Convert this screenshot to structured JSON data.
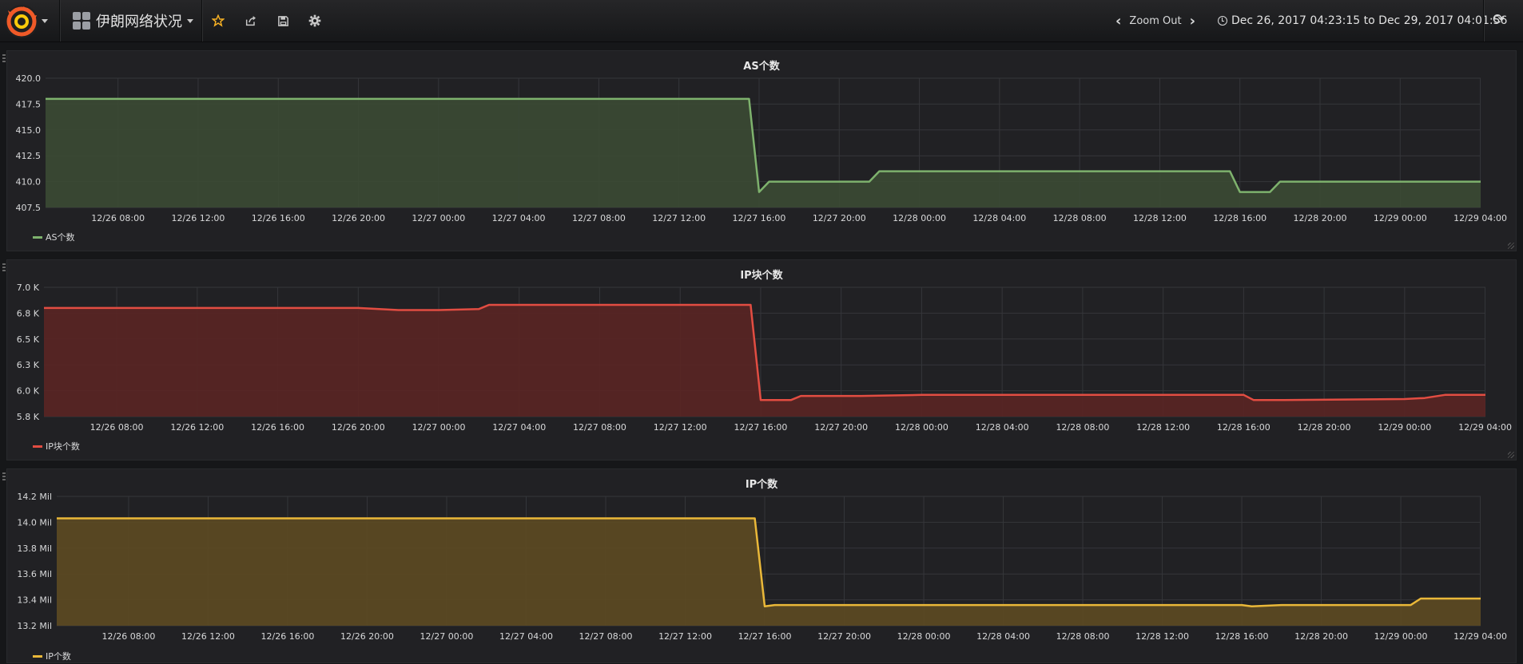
{
  "navbar": {
    "dashboard_title": "伊朗网络状况",
    "zoom_out_label": "Zoom Out",
    "time_range": "Dec 26, 2017 04:23:15 to Dec 29, 2017 04:01:56",
    "icons": [
      "grafana-logo-icon",
      "dashboard-grid-icon",
      "star-icon",
      "share-icon",
      "save-icon",
      "settings-icon",
      "chevron-left-icon",
      "chevron-right-icon",
      "clock-icon",
      "refresh-icon"
    ],
    "colors": {
      "star": "#f6b024"
    }
  },
  "x_ticks": [
    "12/26 08:00",
    "12/26 12:00",
    "12/26 16:00",
    "12/26 20:00",
    "12/27 00:00",
    "12/27 04:00",
    "12/27 08:00",
    "12/27 12:00",
    "12/27 16:00",
    "12/27 20:00",
    "12/28 00:00",
    "12/28 04:00",
    "12/28 08:00",
    "12/28 12:00",
    "12/28 16:00",
    "12/28 20:00",
    "12/29 00:00",
    "12/29 04:00"
  ],
  "panels": [
    {
      "title": "AS个数",
      "legend": "AS个数",
      "y_ticks": [
        "420.0",
        "417.5",
        "415.0",
        "412.5",
        "410.0",
        "407.5"
      ],
      "color": "#7eb26d",
      "fill": "#3b4a34"
    },
    {
      "title": "IP块个数",
      "legend": "IP块个数",
      "y_ticks": [
        "7.0 K",
        "6.8 K",
        "6.5 K",
        "6.3 K",
        "6.0 K",
        "5.8 K"
      ],
      "color": "#e24d42",
      "fill": "#5a2523"
    },
    {
      "title": "IP个数",
      "legend": "IP个数",
      "y_ticks": [
        "14.2 Mil",
        "14.0 Mil",
        "13.8 Mil",
        "13.6 Mil",
        "13.4 Mil",
        "13.2 Mil"
      ],
      "color": "#eab839",
      "fill": "#5d4a22"
    }
  ],
  "chart_data": [
    {
      "type": "area",
      "title": "AS个数",
      "xlim": [
        "2017-12-26 04:23",
        "2017-12-29 04:01"
      ],
      "ylim": [
        407.5,
        420.0
      ],
      "grid": true,
      "legend_position": "bottom-left",
      "series": [
        {
          "name": "AS个数",
          "x": [
            "2017-12-26 04:23",
            "2017-12-27 15:30",
            "2017-12-27 16:00",
            "2017-12-27 16:30",
            "2017-12-27 21:30",
            "2017-12-27 22:00",
            "2017-12-28 15:30",
            "2017-12-28 16:00",
            "2017-12-28 17:30",
            "2017-12-28 18:00",
            "2017-12-29 04:01"
          ],
          "y": [
            418,
            418,
            409,
            410,
            410,
            411,
            411,
            409,
            409,
            410,
            410
          ]
        }
      ]
    },
    {
      "type": "area",
      "title": "IP块个数",
      "xlim": [
        "2017-12-26 04:23",
        "2017-12-29 04:01"
      ],
      "ylim": [
        5750,
        7000
      ],
      "grid": true,
      "legend_position": "bottom-left",
      "series": [
        {
          "name": "IP块个数",
          "x": [
            "2017-12-26 04:23",
            "2017-12-26 20:00",
            "2017-12-26 22:00",
            "2017-12-27 00:00",
            "2017-12-27 02:00",
            "2017-12-27 02:30",
            "2017-12-27 15:30",
            "2017-12-27 16:00",
            "2017-12-27 17:30",
            "2017-12-27 18:00",
            "2017-12-27 21:00",
            "2017-12-28 00:00",
            "2017-12-28 12:00",
            "2017-12-28 16:00",
            "2017-12-28 16:30",
            "2017-12-28 18:00",
            "2017-12-29 00:00",
            "2017-12-29 01:00",
            "2017-12-29 02:00",
            "2017-12-29 04:01"
          ],
          "y": [
            6800,
            6800,
            6780,
            6780,
            6790,
            6830,
            6830,
            5910,
            5910,
            5950,
            5950,
            5960,
            5960,
            5960,
            5910,
            5910,
            5920,
            5930,
            5960,
            5960
          ]
        }
      ]
    },
    {
      "type": "area",
      "title": "IP个数",
      "xlim": [
        "2017-12-26 04:23",
        "2017-12-29 04:01"
      ],
      "ylim": [
        13.2,
        14.2
      ],
      "grid": true,
      "legend_position": "bottom-left",
      "series": [
        {
          "name": "IP个数",
          "x": [
            "2017-12-26 04:23",
            "2017-12-27 15:30",
            "2017-12-27 16:00",
            "2017-12-27 16:30",
            "2017-12-28 16:00",
            "2017-12-28 16:30",
            "2017-12-28 18:00",
            "2017-12-29 00:30",
            "2017-12-29 01:00",
            "2017-12-29 04:01"
          ],
          "y": [
            14.03,
            14.03,
            13.35,
            13.36,
            13.36,
            13.35,
            13.36,
            13.36,
            13.41,
            13.41
          ]
        }
      ]
    }
  ]
}
